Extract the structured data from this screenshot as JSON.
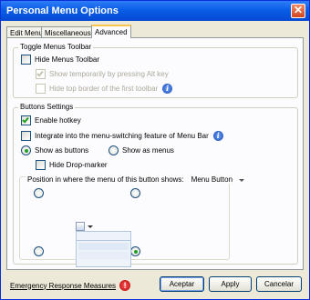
{
  "window": {
    "title": "Personal Menu Options"
  },
  "tabs": [
    {
      "label": "Edit Menus"
    },
    {
      "label": "Miscellaneous"
    },
    {
      "label": "Advanced"
    }
  ],
  "toggle_group": {
    "title": "Toggle Menus Toolbar",
    "hide_toolbar": {
      "label": "Hide Menus Toolbar",
      "checked": false
    },
    "show_temporarily": {
      "label": "Show temporarily by pressing Alt key",
      "checked": true,
      "enabled": false
    },
    "hide_top_border": {
      "label": "Hide top border of the first toolbar",
      "checked": false,
      "enabled": false
    }
  },
  "buttons_group": {
    "title": "Buttons Settings",
    "enable_hotkey": {
      "label": "Enable hotkey",
      "checked": true
    },
    "integrate": {
      "label": "Integrate into the menu-switching feature of Menu Bar",
      "checked": false
    },
    "show_as_buttons": {
      "label": "Show as buttons",
      "selected": true
    },
    "show_as_menus": {
      "label": "Show as menus",
      "selected": false
    },
    "hide_dropmarker": {
      "label": "Hide Drop-marker",
      "checked": false
    }
  },
  "position_group": {
    "label": "Position in where the menu of this button shows:",
    "selected_value": "Menu Button",
    "selected_position": "bottom-right"
  },
  "footer": {
    "emergency_label": "Emergency Response Measures",
    "ok_label": "Aceptar",
    "apply_label": "Apply",
    "cancel_label": "Cancelar"
  },
  "colors": {
    "title_bar": "#0a5ee8",
    "check_mark": "#21a121",
    "active_tab_accent": "#f6c44f"
  }
}
